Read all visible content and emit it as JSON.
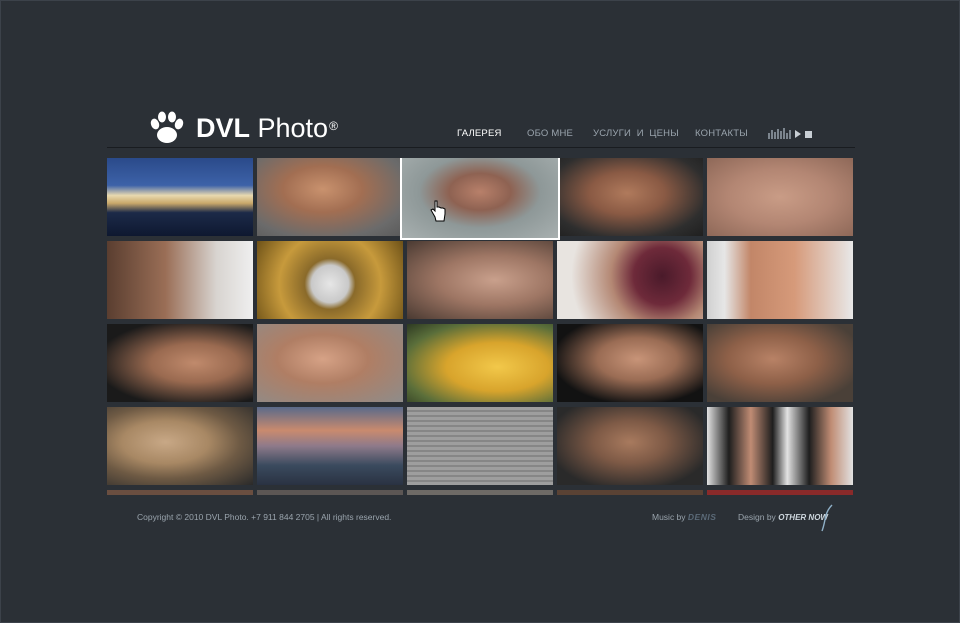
{
  "logo": {
    "text_bold": "DVL",
    "text_light": "Photo",
    "registered": "®"
  },
  "nav": {
    "items": [
      {
        "label": "ГАЛЕРЕЯ",
        "active": true
      },
      {
        "label": "ОБО МНЕ",
        "active": false
      },
      {
        "label": "УСЛУГИ  И  ЦЕНЫ",
        "active": false
      },
      {
        "label": "КОНТАКТЫ",
        "active": false
      }
    ]
  },
  "player": {
    "eq_icon": "equalizer-icon",
    "play_icon": "play-icon",
    "stop_icon": "stop-icon"
  },
  "gallery": {
    "columns": 5,
    "rows_visible": 4.5,
    "hovered_index": 2,
    "thumbnails": [
      "St. Petersburg palace at night",
      "Man lying on arm",
      "Young man portrait on grey",
      "Male torso",
      "Older man eyes close-up",
      "Man with cigarette",
      "Ornate golden clock",
      "Face looking up close-up",
      "Man biting grapes",
      "Torso by window",
      "Hand on shoulder",
      "Smiling young man",
      "Yellow pear with water drops",
      "Man portrait on black",
      "Man with stubble",
      "Man in straw hat",
      "City skyline at sunset",
      "Older man by blinds",
      "Torso with jeans",
      "Two men in white shirts"
    ]
  },
  "footer": {
    "copyright": "Copyright © 2010 DVL Photo. +7 911 844 2705 | All rights reserved.",
    "music_label": "Music by",
    "music_brand": "DENIS",
    "design_label": "Design by",
    "design_brand": "OTHER NOW"
  }
}
